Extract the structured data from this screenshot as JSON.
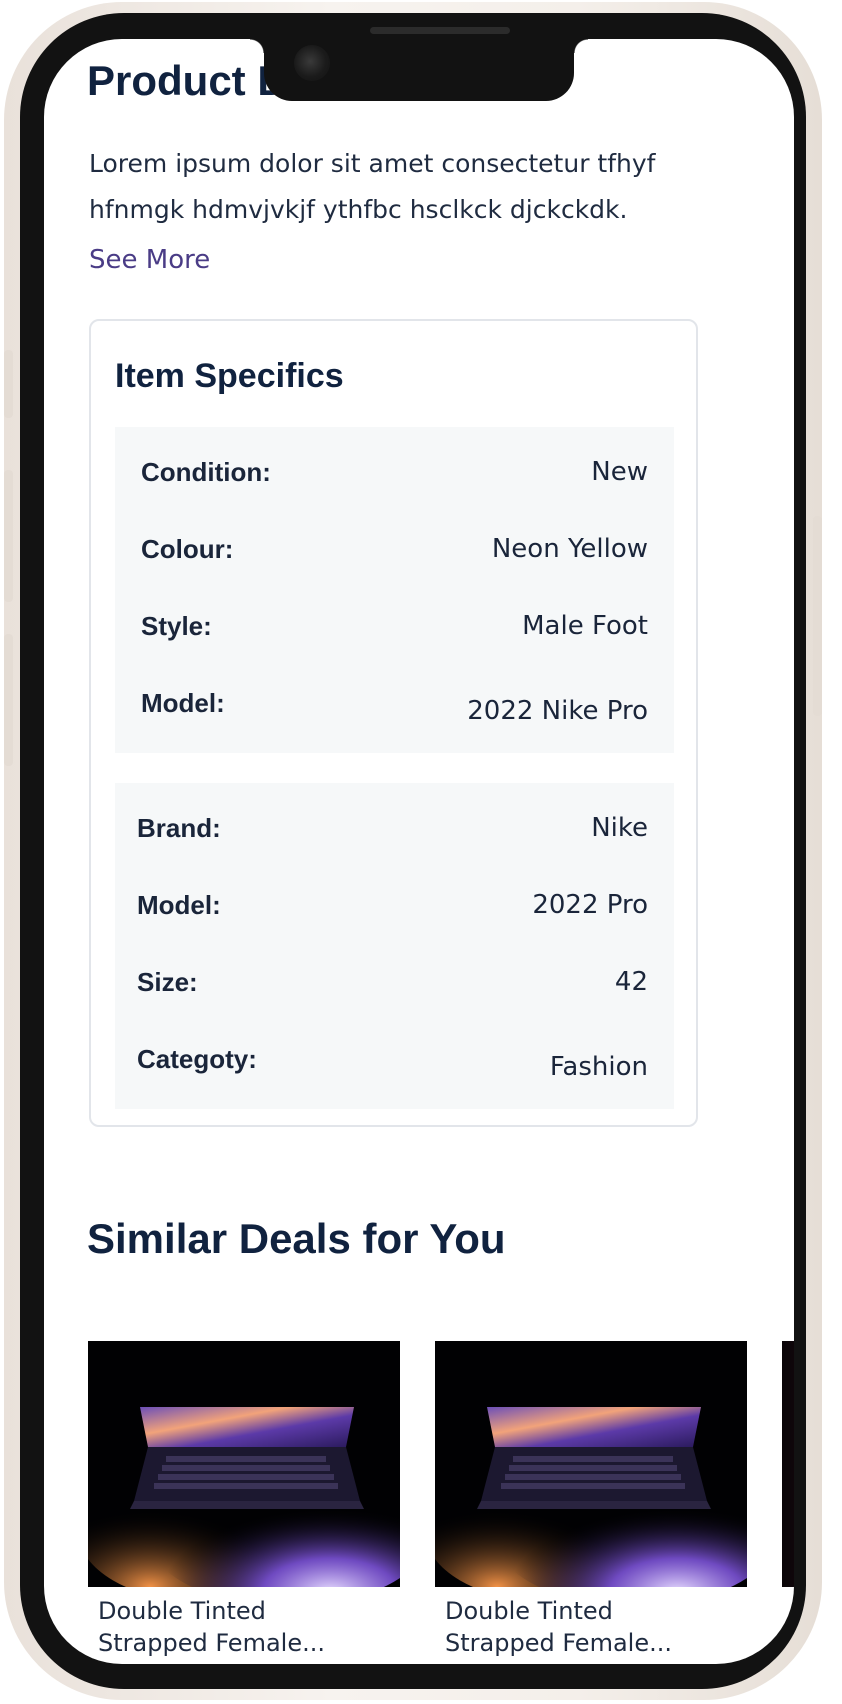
{
  "product_details": {
    "title": "Product Details",
    "description": "Lorem ipsum dolor sit amet consectetur tfhyf hfnmgk hdmvjvkjf ythfbc hsclkck djckckdk.",
    "see_more": "See More"
  },
  "item_specifics": {
    "title": "Item Specifics",
    "group1": [
      {
        "label": "Condition:",
        "value": "New"
      },
      {
        "label": "Colour:",
        "value": "Neon Yellow"
      },
      {
        "label": "Style:",
        "value": "Male Foot"
      },
      {
        "label": "Model:",
        "value": "2022 Nike Pro"
      }
    ],
    "group2": [
      {
        "label": "Brand:",
        "value": "Nike"
      },
      {
        "label": "Model:",
        "value": "2022 Pro"
      },
      {
        "label": "Size:",
        "value": "42"
      },
      {
        "label": "Categoty:",
        "value": "Fashion"
      }
    ]
  },
  "similar_deals": {
    "title": "Similar Deals for You",
    "items": [
      {
        "name_line1": "Double Tinted",
        "name_line2": "Strapped  Female..."
      },
      {
        "name_line1": "Double Tinted",
        "name_line2": "Strapped  Female..."
      }
    ]
  }
}
